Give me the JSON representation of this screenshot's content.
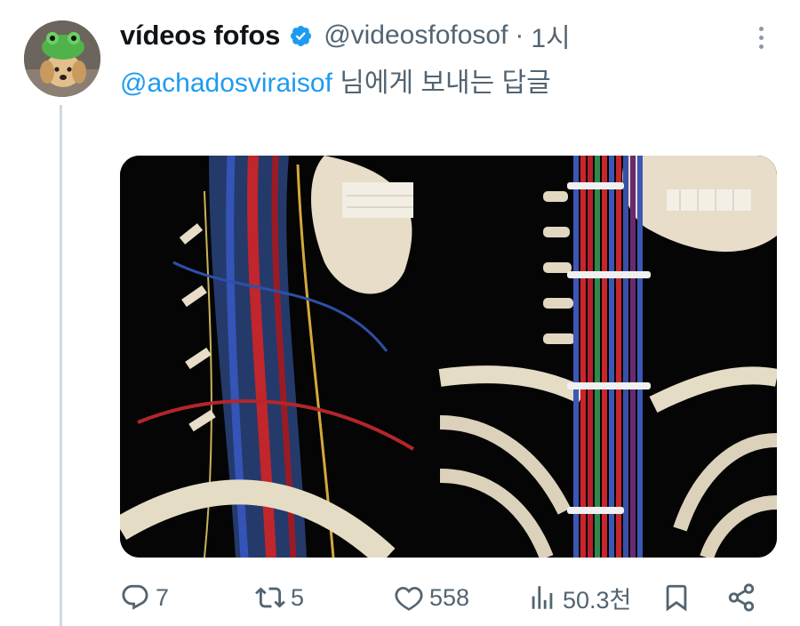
{
  "tweet": {
    "display_name": "vídeos fofos",
    "handle": "@videosfofosof",
    "separator": "·",
    "time": "1시",
    "reply_to_handle": "@achadosviraisof",
    "reply_suffix": " 님에게 보내는 답글"
  },
  "icons": {
    "verified": "verified-badge-icon",
    "more": "more-vertical-icon",
    "reply": "reply-icon",
    "retweet": "retweet-icon",
    "like": "heart-icon",
    "views": "views-chart-icon",
    "bookmark": "bookmark-icon",
    "share": "share-icon"
  },
  "actions": {
    "replies": "7",
    "retweets": "5",
    "likes": "558",
    "views": "50.3천"
  },
  "colors": {
    "accent": "#1d9bf0",
    "muted": "#536471",
    "text": "#0f1419"
  }
}
